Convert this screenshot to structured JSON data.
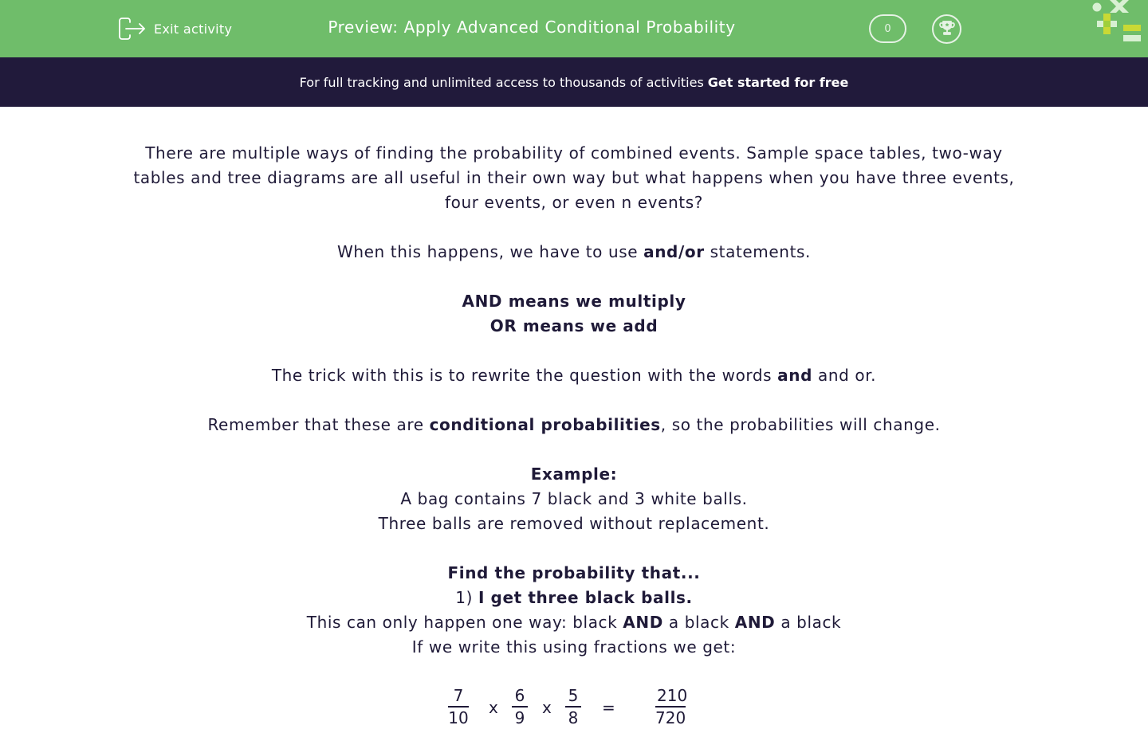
{
  "header": {
    "exit_label": "Exit activity",
    "title": "Preview: Apply Advanced Conditional Probability",
    "score": "0",
    "colors": {
      "bar": "#6fbd6a",
      "banner": "#211a3b"
    }
  },
  "banner": {
    "text": "For full tracking and unlimited access to thousands of activities",
    "cta": "Get started for free"
  },
  "content": {
    "intro": "There are multiple ways of finding the probability of combined events. Sample space tables, two-way tables and tree diagrams are all useful in their own way but what happens when you have three events, four events, or even n events?",
    "andor_pre": "When this happens, we have to use ",
    "andor_bold": "and/or",
    "andor_post": " statements.",
    "rule_and": "AND means we multiply",
    "rule_or": "OR means we add",
    "trick_pre": "The trick with this is to rewrite the question with the words ",
    "trick_bold": "and",
    "trick_post": " and or.",
    "remember_pre": "Remember that these are ",
    "remember_bold": "conditional probabilities",
    "remember_post": ", so the probabilities will change.",
    "example_heading": "Example:",
    "example_line1": "A bag contains 7 black and 3 white balls.",
    "example_line2": "Three balls are removed without replacement.",
    "find_heading": "Find the probability that...",
    "q1_number": "1) ",
    "q1_text": "I get three black balls.",
    "way_pre": "This can only happen one way: black ",
    "way_and1": "AND",
    "way_mid": " a black ",
    "way_and2": "AND",
    "way_post": " a black",
    "fractions_intro": "If we write this using fractions we get:",
    "equation": {
      "f1": {
        "num": "7",
        "den": "10"
      },
      "op1": "x",
      "f2": {
        "num": "6",
        "den": "9"
      },
      "op2": "x",
      "f3": {
        "num": "5",
        "den": "8"
      },
      "eq": "=",
      "result": {
        "num": "210",
        "den": "720"
      }
    }
  }
}
